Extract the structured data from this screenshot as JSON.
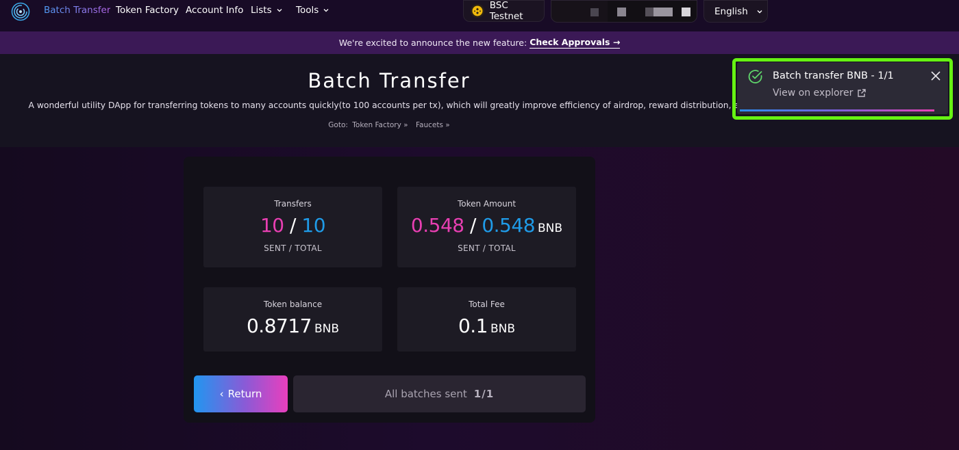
{
  "nav": {
    "items": [
      {
        "label": "Batch Transfer"
      },
      {
        "label": "Token Factory"
      },
      {
        "label": "Account Info"
      },
      {
        "label": "Lists"
      },
      {
        "label": "Tools"
      }
    ],
    "network": "BSC Testnet",
    "language": "English"
  },
  "announcement": {
    "text": "We're excited to announce the new feature:",
    "link": "Check Approvals",
    "arrow": "→"
  },
  "hero": {
    "title": "Batch Transfer",
    "description": "A wonderful utility DApp for transferring tokens to many accounts quickly(to 100 accounts per tx), which will greatly improve efficiency of airdrop, reward distribution, etc.",
    "goto_label": "Goto:",
    "goto_links": [
      "Token Factory »",
      "Faucets »"
    ]
  },
  "stats": {
    "transfers": {
      "label": "Transfers",
      "sent": "10",
      "sep": "/",
      "total": "10",
      "sub": "SENT / TOTAL"
    },
    "amount": {
      "label": "Token Amount",
      "sent": "0.548",
      "sep": "/",
      "total": "0.548",
      "unit": "BNB",
      "sub": "SENT / TOTAL"
    },
    "balance": {
      "label": "Token balance",
      "value": "0.8717",
      "unit": "BNB"
    },
    "fee": {
      "label": "Total Fee",
      "value": "0.1",
      "unit": "BNB"
    }
  },
  "actions": {
    "return_label": "Return",
    "return_icon": "‹",
    "batches_label": "All batches sent",
    "batches_count": "1/1"
  },
  "toast": {
    "title": "Batch transfer BNB - 1/1",
    "link": "View on explorer",
    "highlight_color": "#66f213"
  },
  "colors": {
    "sent": "#e83fb2",
    "total": "#1f9be8"
  }
}
